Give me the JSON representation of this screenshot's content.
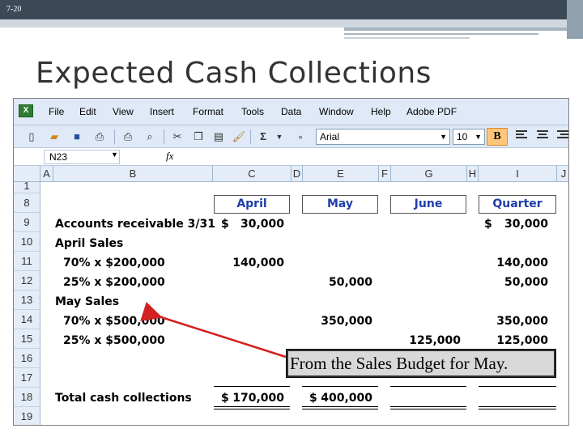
{
  "slide": {
    "number": "7-20",
    "title": "Expected Cash Collections"
  },
  "excel": {
    "menu": [
      "File",
      "Edit",
      "View",
      "Insert",
      "Format",
      "Tools",
      "Data",
      "Window",
      "Help",
      "Adobe PDF"
    ],
    "toolbar": {
      "font_name": "Arial",
      "font_size": "10",
      "bold_label": "B",
      "sum_label": "Σ"
    },
    "name_box": "N23",
    "fx_label": "fx",
    "columns": [
      "A",
      "B",
      "C",
      "D",
      "E",
      "F",
      "G",
      "H",
      "I",
      "J"
    ],
    "rows": [
      "1",
      "8",
      "9",
      "10",
      "11",
      "12",
      "13",
      "14",
      "15",
      "16",
      "17",
      "18",
      "19"
    ],
    "headers": {
      "april": "April",
      "may": "May",
      "june": "June",
      "quarter": "Quarter"
    },
    "cells": {
      "ar_label": "Accounts receivable 3/31",
      "ar_dollar": "$",
      "ar_april": "30,000",
      "ar_q_dollar": "$",
      "ar_quarter": "30,000",
      "april_sales": "April Sales",
      "r11_label": "70% x $200,000",
      "r11_april": "140,000",
      "r11_quarter": "140,000",
      "r12_label": "25% x $200,000",
      "r12_may": "50,000",
      "r12_quarter": "50,000",
      "may_sales": "May Sales",
      "r14_label": "70% x $500,000",
      "r14_may": "350,000",
      "r14_quarter": "350,000",
      "r15_label": "25% x $500,000",
      "r15_june": "125,000",
      "r15_quarter": "125,000",
      "total_label": "Total cash collections",
      "total_april_dollar": "$",
      "total_april": "170,000",
      "total_may_dollar": "$",
      "total_may": "400,000"
    },
    "callout": "From the Sales Budget for May."
  },
  "colors": {
    "header_text": "#1f3ea8",
    "arrow": "#d32020",
    "menubar": "#dfe9f7"
  }
}
